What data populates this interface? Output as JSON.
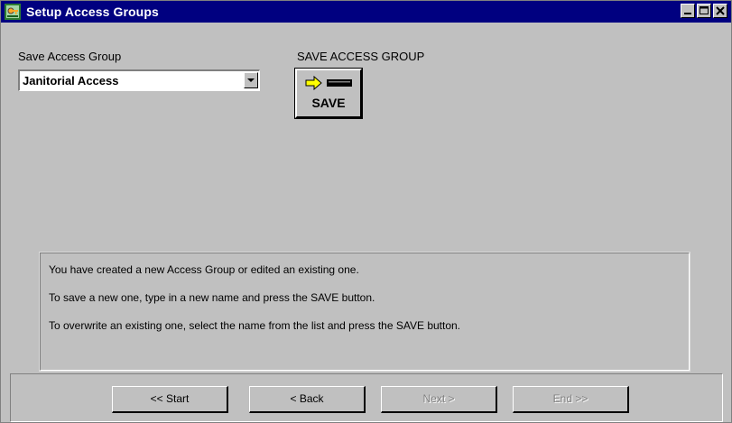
{
  "window": {
    "title": "Setup Access Groups",
    "icon": "app-key-icon",
    "controls": [
      "minimize-icon",
      "maximize-icon",
      "close-icon"
    ]
  },
  "save_group": {
    "label": "Save Access Group",
    "selected_value": "Janitorial Access"
  },
  "save_section": {
    "heading": "SAVE ACCESS GROUP",
    "button_label": "SAVE",
    "button_icon": "save-arrow-icon"
  },
  "info": {
    "lines": [
      "You have created a new Access Group or edited an existing one.",
      "To save a new one,  type in a new name and press the SAVE button.",
      "To overwrite an existing one, select the name from the list and press the SAVE button."
    ]
  },
  "nav": {
    "start": "<< Start",
    "back": "< Back",
    "next": "Next >",
    "end": "End >>"
  },
  "colors": {
    "titlebar": "#000080",
    "face": "#c0c0c0",
    "disabled_text": "#808080",
    "arrow_yellow": "#ffff00"
  }
}
